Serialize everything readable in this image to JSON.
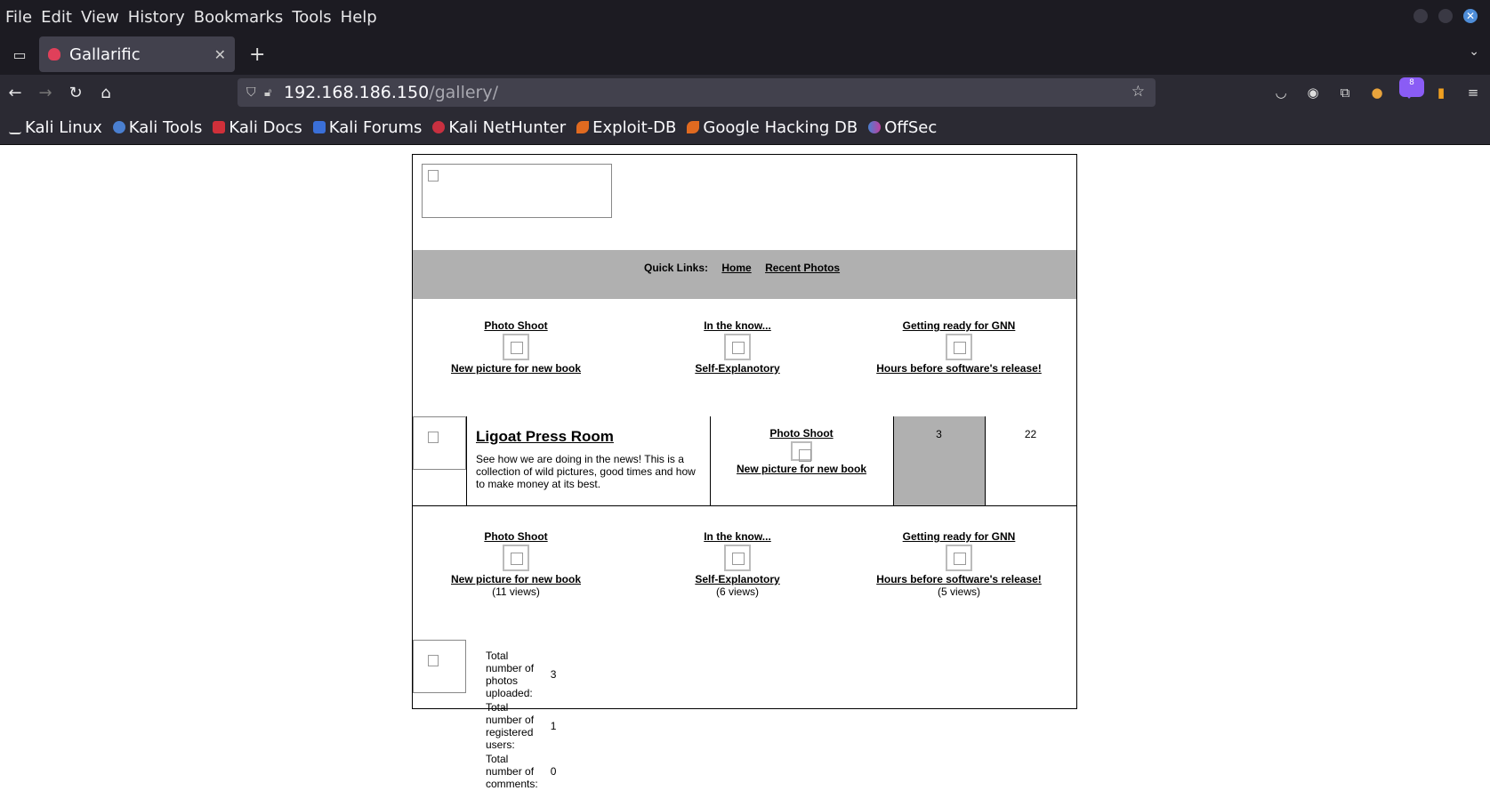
{
  "menu": [
    "File",
    "Edit",
    "View",
    "History",
    "Bookmarks",
    "Tools",
    "Help"
  ],
  "tab": {
    "title": "Gallarific"
  },
  "url": {
    "host": "192.168.186.150",
    "path": "/gallery/"
  },
  "extension_badge": "8",
  "bookmarks": [
    "Kali Linux",
    "Kali Tools",
    "Kali Docs",
    "Kali Forums",
    "Kali NetHunter",
    "Exploit-DB",
    "Google Hacking DB",
    "OffSec"
  ],
  "quick_links": {
    "label": "Quick Links:",
    "home": "Home",
    "recent": "Recent Photos"
  },
  "top_photos": [
    {
      "title": "Photo Shoot",
      "desc": "New picture for new book"
    },
    {
      "title": "In the know...",
      "desc": "Self-Explanotory"
    },
    {
      "title": "Getting ready for GNN",
      "desc": "Hours before software's release!"
    }
  ],
  "category": {
    "title": "Ligoat Press Room",
    "description": "See how we are doing in the news! This is a collection of wild pictures, good times and how to make money at its best.",
    "photo_title": "Photo Shoot",
    "photo_desc": "New picture for new book",
    "count1": "3",
    "count2": "22"
  },
  "popular_photos": [
    {
      "title": "Photo Shoot",
      "desc": "New picture for new book",
      "views": "(11 views)"
    },
    {
      "title": "In the know...",
      "desc": "Self-Explanotory",
      "views": "(6 views)"
    },
    {
      "title": "Getting ready for GNN",
      "desc": "Hours before software's release!",
      "views": "(5 views)"
    }
  ],
  "stats": [
    {
      "label": "Total number of photos uploaded:",
      "value": "3"
    },
    {
      "label": "Total number of registered users:",
      "value": "1"
    },
    {
      "label": "Total number of comments:",
      "value": "0"
    }
  ]
}
